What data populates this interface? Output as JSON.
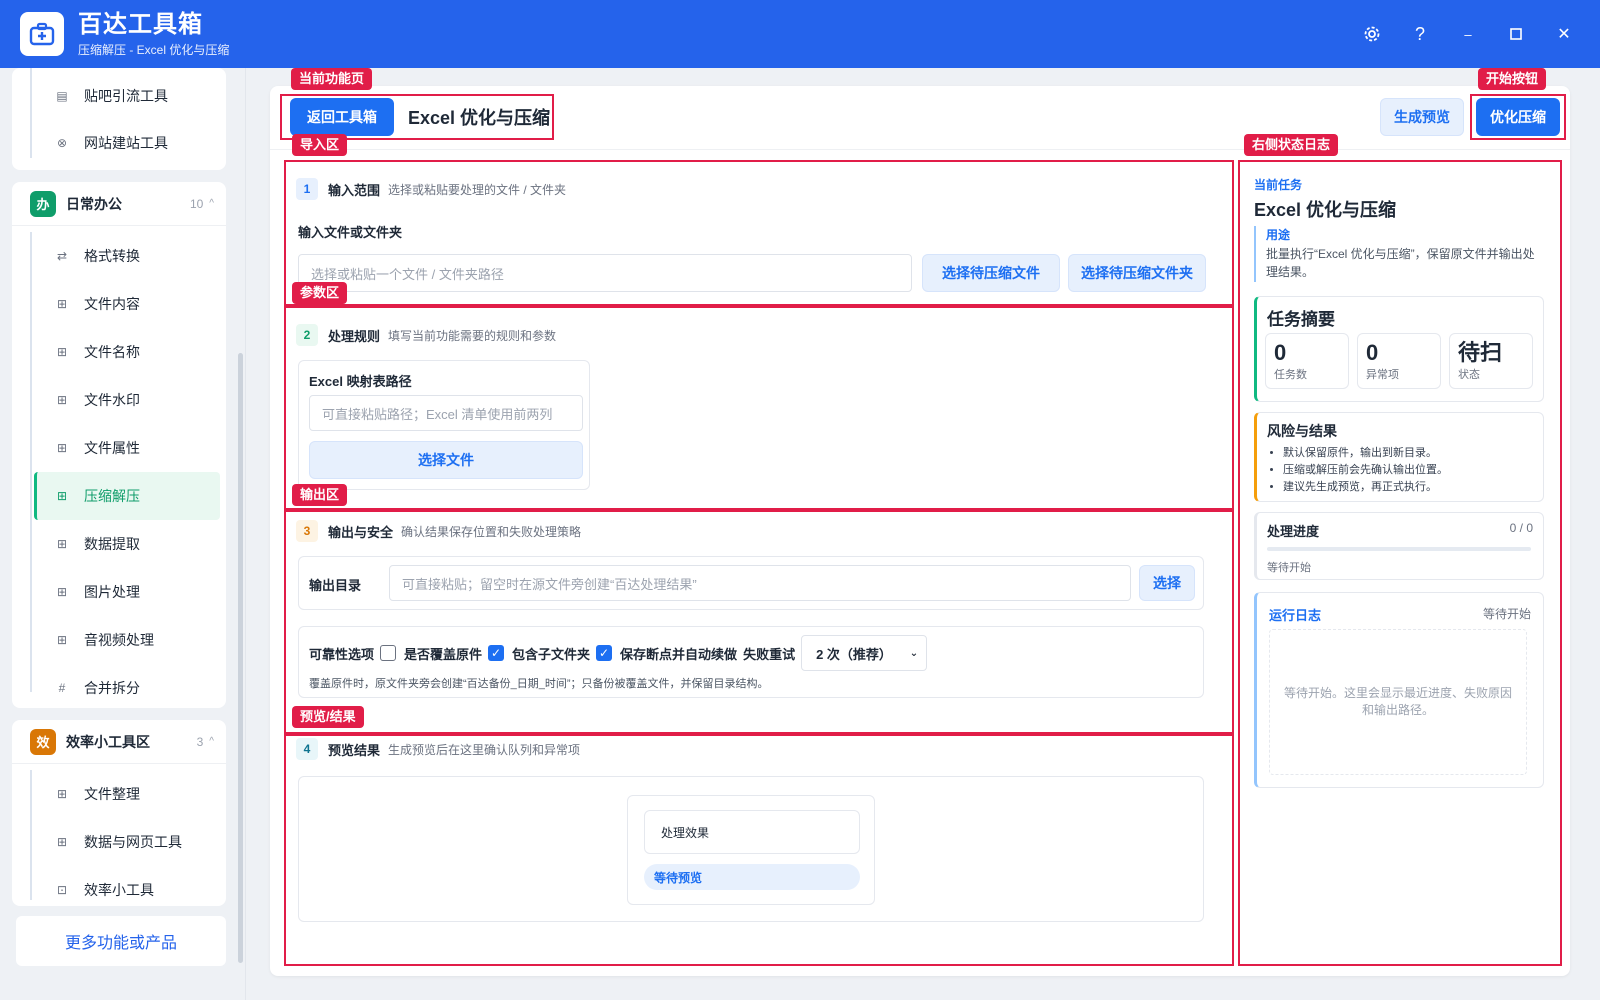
{
  "app": {
    "title": "百达工具箱",
    "subtitle": "压缩解压 - Excel 优化与压缩"
  },
  "window": {
    "settings_icon": "gear-icon",
    "help_label": "?",
    "minimize_label": "–",
    "maximize_label": "□",
    "close_label": "✕"
  },
  "sidebar": {
    "top_items": [
      {
        "label": "贴吧引流工具",
        "icon": "document-icon"
      },
      {
        "label": "网站建站工具",
        "icon": "globe-icon"
      }
    ],
    "groups": [
      {
        "badge": "办",
        "badge_color": "#0f9d6a",
        "name": "日常办公",
        "count": "10",
        "caret": "^",
        "items": [
          {
            "label": "格式转换",
            "icon": "swap-icon"
          },
          {
            "label": "文件内容",
            "icon": "grid-icon"
          },
          {
            "label": "文件名称",
            "icon": "grid-icon"
          },
          {
            "label": "文件水印",
            "icon": "grid-icon"
          },
          {
            "label": "文件属性",
            "icon": "grid-icon"
          },
          {
            "label": "压缩解压",
            "icon": "grid-icon",
            "active": true
          },
          {
            "label": "数据提取",
            "icon": "grid-icon"
          },
          {
            "label": "图片处理",
            "icon": "grid-icon"
          },
          {
            "label": "音视频处理",
            "icon": "grid-icon"
          },
          {
            "label": "合并拆分",
            "icon": "hash-icon"
          }
        ]
      },
      {
        "badge": "效",
        "badge_color": "#d97706",
        "name": "效率小工具区",
        "count": "3",
        "caret": "^",
        "items": [
          {
            "label": "文件整理",
            "icon": "grid-icon"
          },
          {
            "label": "数据与网页工具",
            "icon": "grid-icon"
          },
          {
            "label": "效率小工具",
            "icon": "toolbox-icon"
          }
        ]
      }
    ],
    "more_label": "更多功能或产品"
  },
  "topbar": {
    "back_label": "返回工具箱",
    "page_title": "Excel 优化与压缩",
    "preview_label": "生成预览",
    "start_label": "优化压缩"
  },
  "sections": {
    "input": {
      "num": "1",
      "title": "输入范围",
      "desc": "选择或粘贴要处理的文件 / 文件夹",
      "field_label": "输入文件或文件夹",
      "placeholder": "选择或粘贴一个文件 / 文件夹路径",
      "btn_file": "选择待压缩文件",
      "btn_folder": "选择待压缩文件夹"
    },
    "params": {
      "num": "2",
      "title": "处理规则",
      "desc": "填写当前功能需要的规则和参数",
      "field_label": "Excel 映射表路径",
      "placeholder": "可直接粘贴路径；Excel 清单使用前两列",
      "btn_select": "选择文件"
    },
    "output": {
      "num": "3",
      "title": "输出与安全",
      "desc": "确认结果保存位置和失败处理策略",
      "dir_label": "输出目录",
      "dir_placeholder": "可直接粘贴；留空时在源文件旁创建“百达处理结果”",
      "dir_btn": "选择",
      "opt_label": "可靠性选项",
      "overwrite_label": "是否覆盖原件",
      "overwrite_checked": false,
      "subfolder_label": "包含子文件夹",
      "subfolder_checked": true,
      "resume_label": "保存断点并自动续做",
      "resume_checked": true,
      "retry_label": "失败重试",
      "retry_value": "2 次（推荐）",
      "note": "覆盖原件时，原文件夹旁会创建“百达备份_日期_时间”；只备份被覆盖文件，并保留目录结构。"
    },
    "preview": {
      "num": "4",
      "title": "预览结果",
      "desc": "生成预览后在这里确认队列和异常项",
      "effect_label": "处理效果",
      "status_pill": "等待预览"
    }
  },
  "right_panel": {
    "current_task_label": "当前任务",
    "task_title": "Excel 优化与压缩",
    "purpose_label": "用途",
    "purpose_text": "批量执行“Excel 优化与压缩”，保留原文件并输出处理结果。",
    "summary_title": "任务摘要",
    "stats": [
      {
        "value": "0",
        "label": "任务数"
      },
      {
        "value": "0",
        "label": "异常项"
      },
      {
        "value": "待扫",
        "label": "状态"
      }
    ],
    "risk_title": "风险与结果",
    "risk_items": [
      "默认保留原件，输出到新目录。",
      "压缩或解压前会先确认输出位置。",
      "建议先生成预览，再正式执行。"
    ],
    "progress_title": "处理进度",
    "progress_count": "0 / 0",
    "progress_fraction": 0,
    "progress_status": "等待开始",
    "log_title": "运行日志",
    "log_status": "等待开始",
    "log_placeholder": "等待开始。这里会显示最近进度、失败原因和输出路径。"
  },
  "annotations": {
    "current_page": "当前功能页",
    "start_button": "开始按钮",
    "import_area": "导入区",
    "status_log": "右侧状态日志",
    "params_area": "参数区",
    "output_area": "输出区",
    "preview_area": "预览/结果"
  },
  "colors": {
    "primary": "#1d6ff2",
    "titlebar": "#2563eb",
    "annotation": "#e11d48",
    "success": "#10b981",
    "warning": "#d97706"
  }
}
